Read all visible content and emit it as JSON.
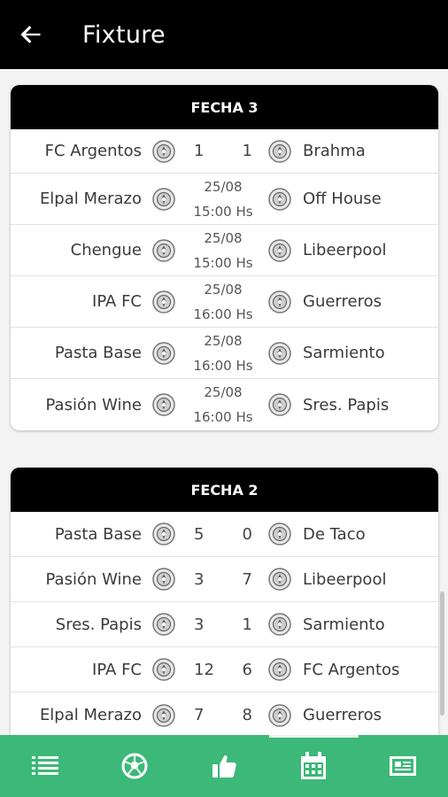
{
  "app_bar": {
    "title": "Fixture",
    "back_icon": "arrow-left-icon"
  },
  "colors": {
    "accent": "#3cb878",
    "header": "#000000"
  },
  "fechas": [
    {
      "label": "FECHA 3",
      "matches": [
        {
          "home": "FC Argentos",
          "away": "Brahma",
          "home_score": "1",
          "away_score": "1"
        },
        {
          "home": "Elpal Merazo",
          "away": "Off House",
          "date": "25/08",
          "time": "15:00 Hs"
        },
        {
          "home": "Chengue",
          "away": "Libeerpool",
          "date": "25/08",
          "time": "15:00 Hs"
        },
        {
          "home": "IPA FC",
          "away": "Guerreros",
          "date": "25/08",
          "time": "16:00 Hs"
        },
        {
          "home": "Pasta Base",
          "away": "Sarmiento",
          "date": "25/08",
          "time": "16:00 Hs"
        },
        {
          "home": "Pasión Wine",
          "away": "Sres. Papis",
          "date": "25/08",
          "time": "16:00 Hs"
        }
      ]
    },
    {
      "label": "FECHA 2",
      "matches": [
        {
          "home": "Pasta Base",
          "away": "De Taco",
          "home_score": "5",
          "away_score": "0"
        },
        {
          "home": "Pasión Wine",
          "away": "Libeerpool",
          "home_score": "3",
          "away_score": "7"
        },
        {
          "home": "Sres. Papis",
          "away": "Sarmiento",
          "home_score": "3",
          "away_score": "1"
        },
        {
          "home": "IPA FC",
          "away": "FC Argentos",
          "home_score": "12",
          "away_score": "6"
        },
        {
          "home": "Elpal Merazo",
          "away": "Guerreros",
          "home_score": "7",
          "away_score": "8"
        }
      ]
    }
  ],
  "bottom_nav": [
    {
      "icon": "list-icon",
      "active": false
    },
    {
      "icon": "soccer-ball-icon",
      "active": false
    },
    {
      "icon": "thumbs-up-icon",
      "active": false
    },
    {
      "icon": "calendar-icon",
      "active": true
    },
    {
      "icon": "newspaper-icon",
      "active": false
    }
  ]
}
